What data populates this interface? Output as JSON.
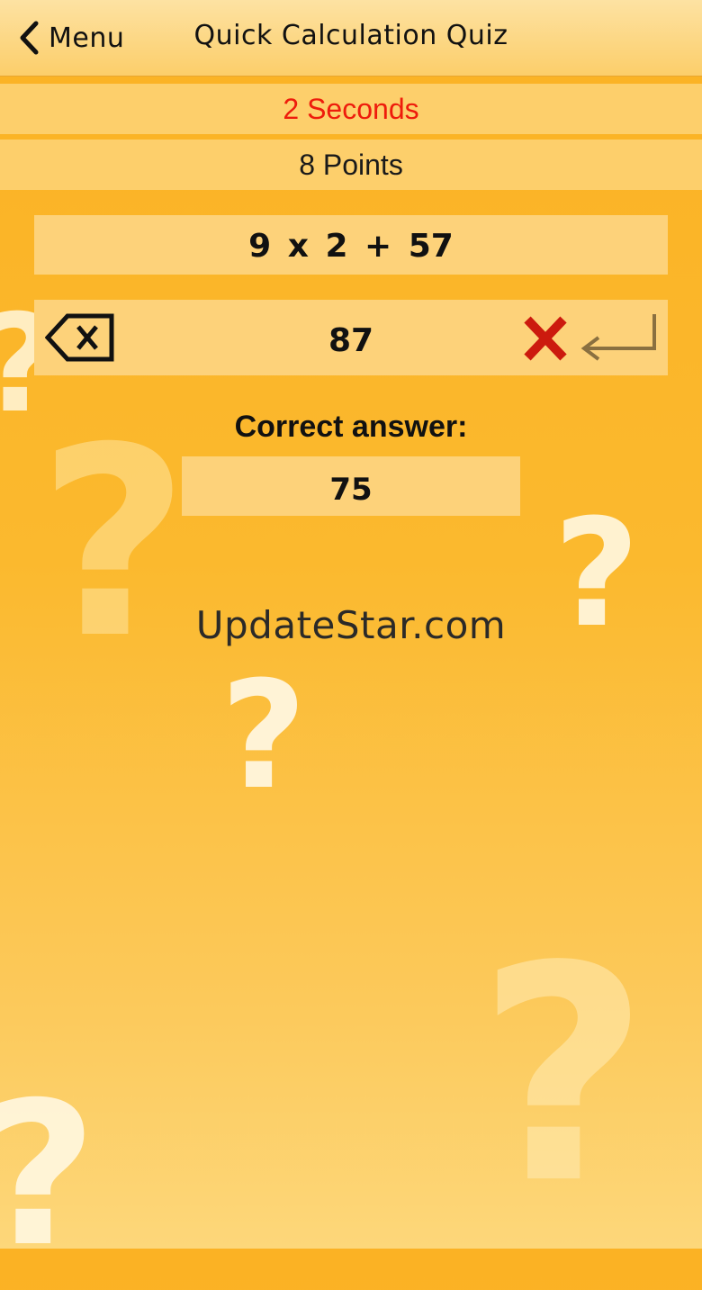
{
  "nav": {
    "back_label": "Menu",
    "title": "Quick Calculation Quiz"
  },
  "status": {
    "timer": "2 Seconds",
    "points": "8 Points"
  },
  "quiz": {
    "question": "9 x 2 + 57",
    "user_answer": "87",
    "correct_answer_label": "Correct answer:",
    "correct_answer": "75"
  },
  "watermark": "UpdateStar.com",
  "decoration": {
    "symbol": "?"
  },
  "colors": {
    "timer_text": "#ee1c0c",
    "wrong_mark": "#cc1a0e",
    "background_top": "#fbb224",
    "background_bottom": "#fdd77a",
    "box_fill": "#fdd27a"
  },
  "icons": {
    "back": "chevron-left-icon",
    "backspace": "backspace-icon",
    "wrong": "wrong-x-icon",
    "enter": "enter-return-icon"
  }
}
